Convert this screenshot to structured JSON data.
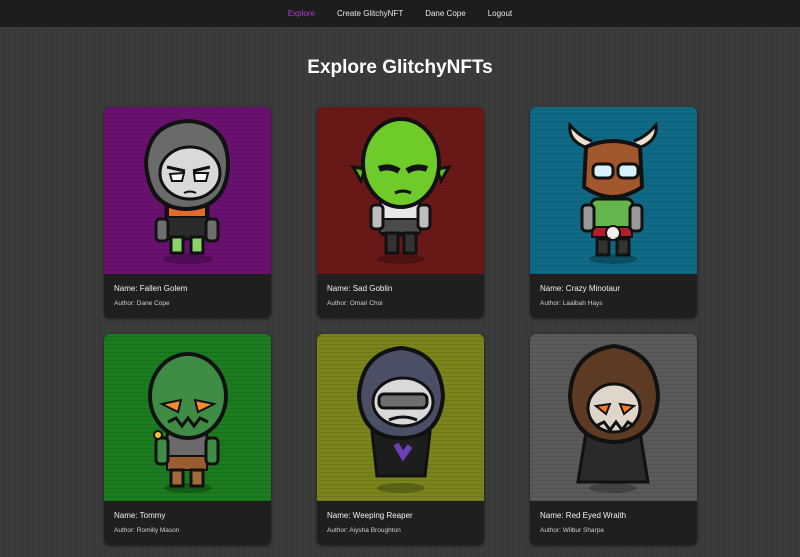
{
  "nav": [
    {
      "label": "Explore",
      "active": true
    },
    {
      "label": "Create GlitchyNFT",
      "active": false
    },
    {
      "label": "Dane Cope",
      "active": false
    },
    {
      "label": "Logout",
      "active": false
    }
  ],
  "page_title": "Explore GlitchyNFTs",
  "cards": [
    {
      "name": "Name: Fallen Golem",
      "author": "Author: Dane Cope",
      "bg": "#6a1170",
      "icon": "golem-icon"
    },
    {
      "name": "Name: Sad Goblin",
      "author": "Author: Omari Choi",
      "bg": "#6b1818",
      "icon": "goblin-icon"
    },
    {
      "name": "Name: Crazy Minotaur",
      "author": "Author: Laaibah Hays",
      "bg": "#0f6a86",
      "icon": "minotaur-icon"
    },
    {
      "name": "Name: Tommy",
      "author": "Author: Romilly Mason",
      "bg": "#1b7b1f",
      "icon": "orc-icon"
    },
    {
      "name": "Name: Weeping Reaper",
      "author": "Author: Aiysha Broughton",
      "bg": "#7a841b",
      "icon": "reaper-icon"
    },
    {
      "name": "Name: Red Eyed Wraith",
      "author": "Author: Wilbur Sharpe",
      "bg": "#5a5a5a",
      "icon": "wraith-icon"
    }
  ]
}
